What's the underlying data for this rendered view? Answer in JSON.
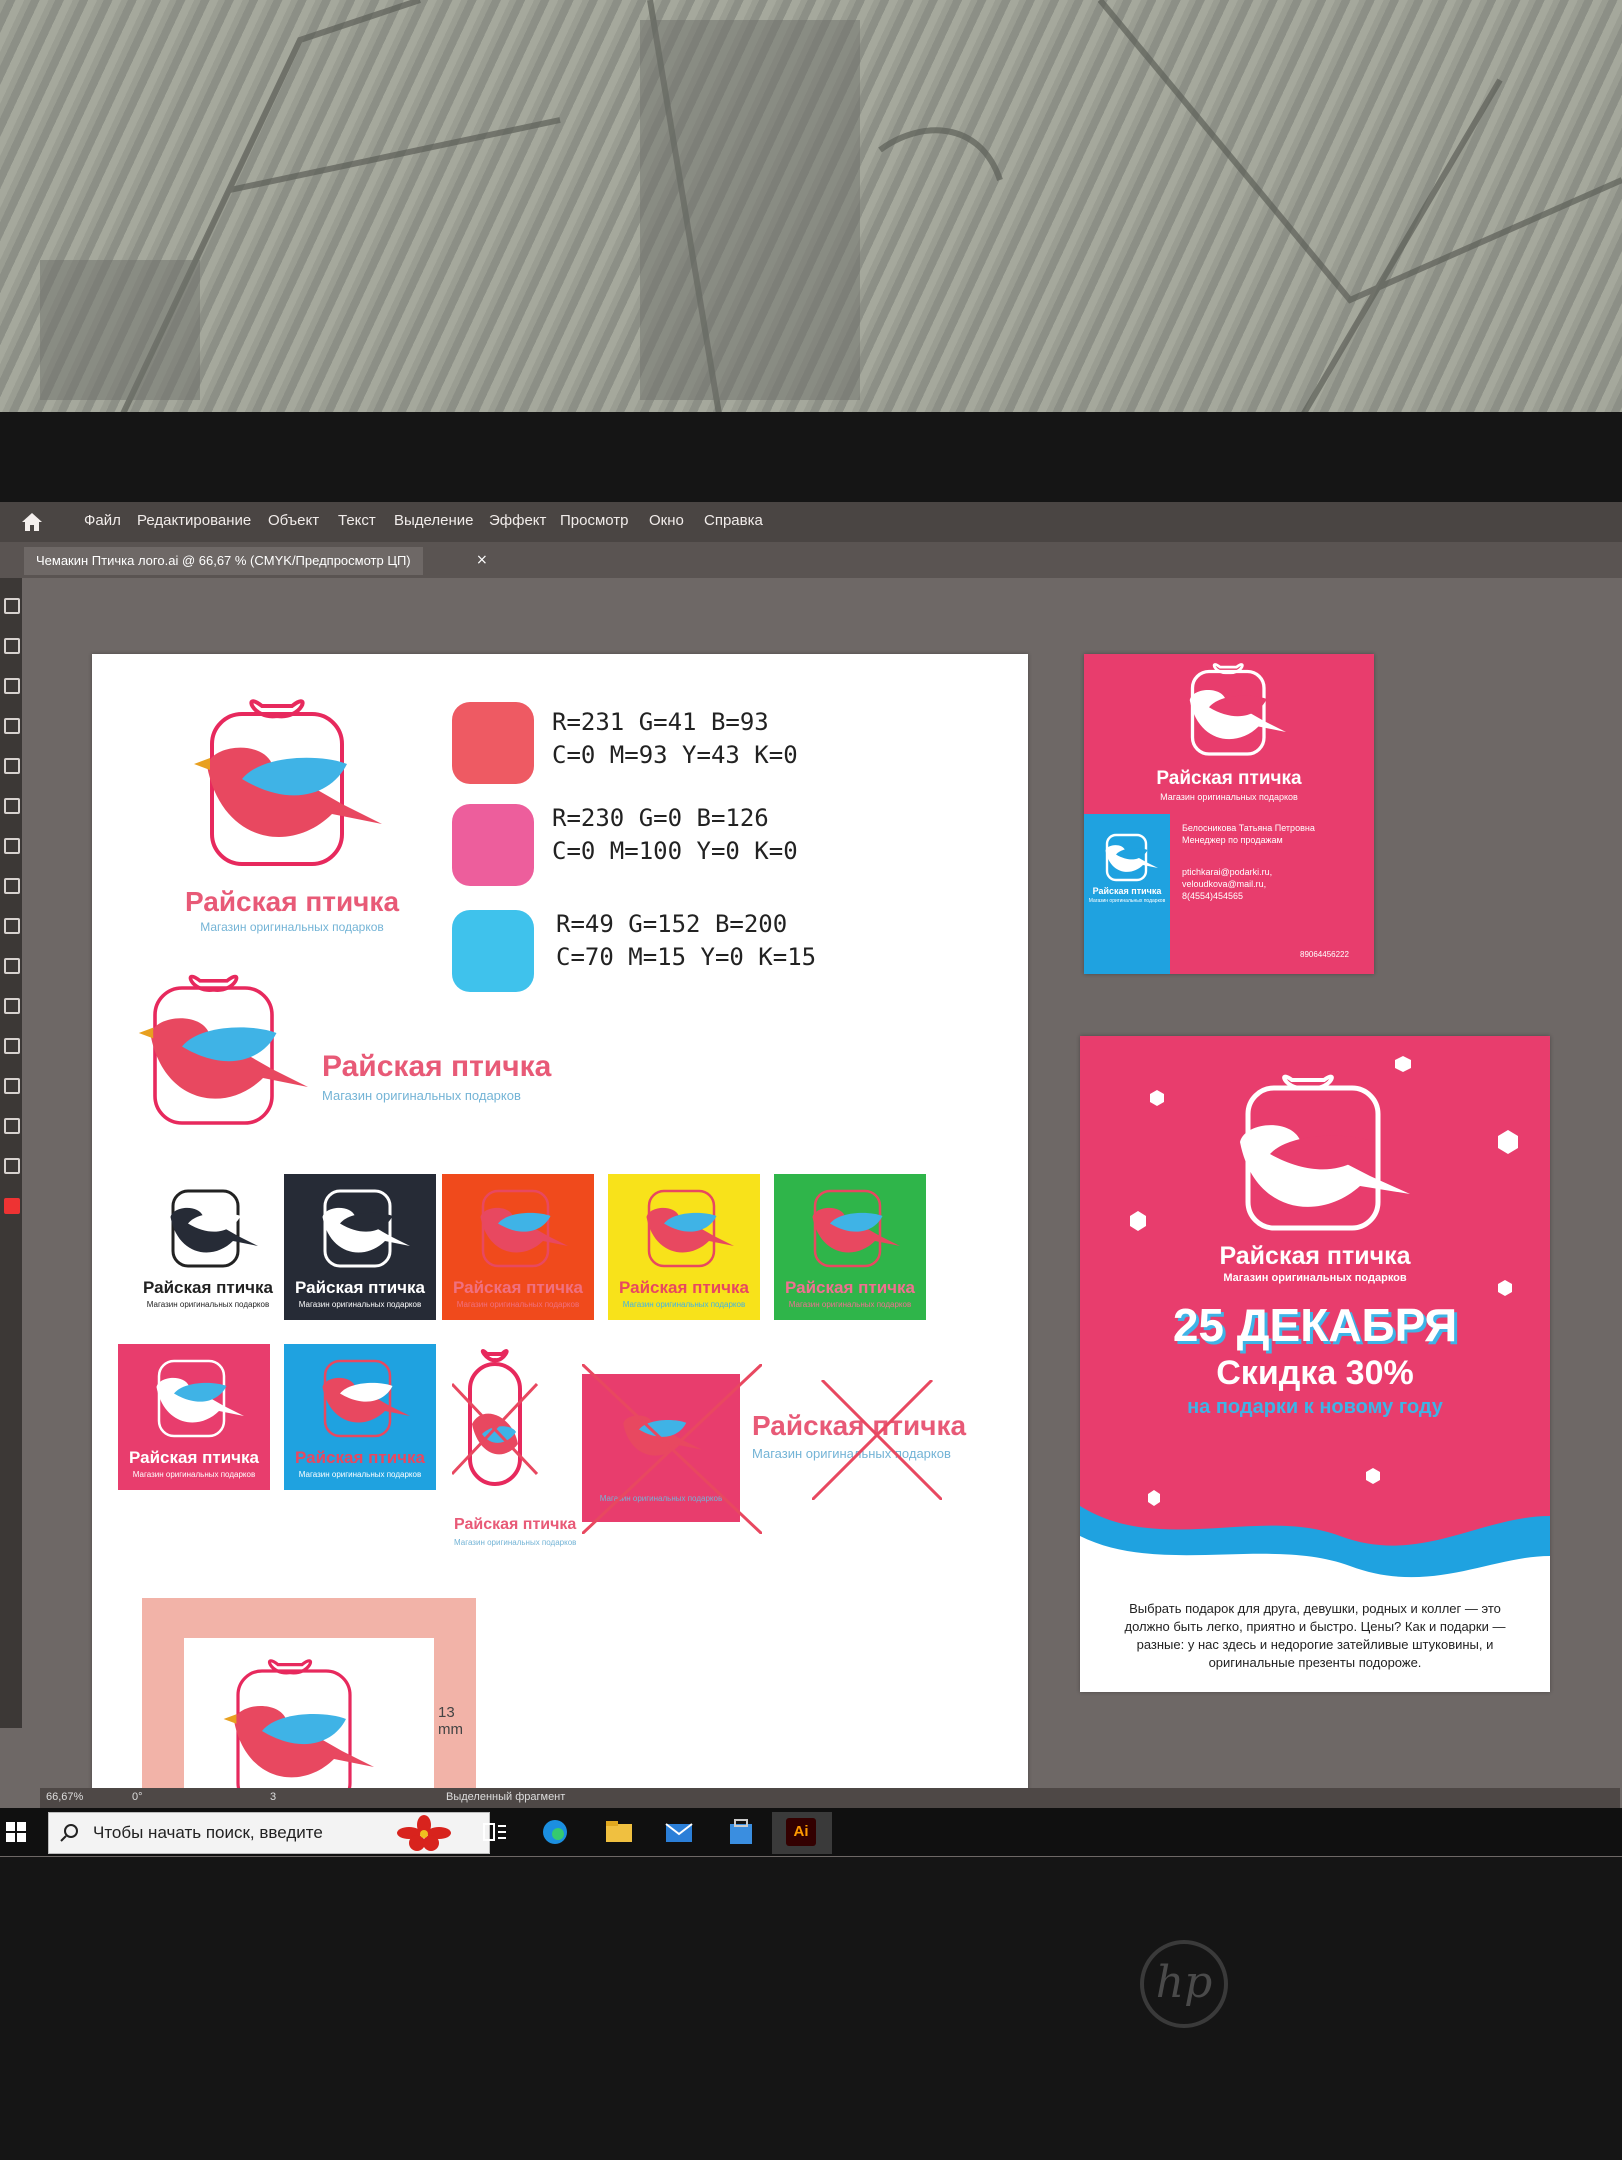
{
  "menu": {
    "items": [
      "Файл",
      "Редактирование",
      "Объект",
      "Текст",
      "Выделение",
      "Эффект",
      "Просмотр",
      "Окно",
      "Справка"
    ]
  },
  "document": {
    "tab_title": "Чемакин Птичка лого.ai @ 66,67 % (CMYK/Предпросмотр ЦП)",
    "close_glyph": "×"
  },
  "brand": {
    "name": "Райская птичка",
    "tagline": "Магазин оригинальных подарков"
  },
  "palette": [
    {
      "color": "#e7295d",
      "rgb": "R=231 G=41 B=93",
      "cmyk": "C=0 M=93 Y=43 K=0"
    },
    {
      "color": "#e6007e",
      "rgb": "R=230 G=0 B=126",
      "cmyk": "C=0 M=100 Y=0 K=0"
    },
    {
      "color": "#3198c8",
      "rgb": "R=49 G=152 B=200",
      "cmyk": "C=70 M=15 Y=0 K=15"
    }
  ],
  "swatch_display_colors": [
    "#ee5a63",
    "#ed5e9c",
    "#3fc2ec"
  ],
  "measure": {
    "value": "13",
    "unit": "mm"
  },
  "business_card": {
    "name": "Белосникова Татьяна Петровна",
    "role": "Менеджер по продажам",
    "email1": "ptichkarai@podarki.ru,",
    "email2": "veloudkova@mail.ru,",
    "phone1": "8(4554)454565",
    "phone2": "89064456222"
  },
  "flyer": {
    "date": "25 ДЕКАБРЯ",
    "discount": "Скидка 30%",
    "subline": "на подарки к новому году",
    "body": "Выбрать подарок для друга, девушки, родных и коллег — это должно быть легко, приятно и быстро. Цены? Как и подарки — разные: у нас здесь и недорогие затейливые штуковины, и оригинальные презенты подороже."
  },
  "statusbar": {
    "zoom": "66,67%",
    "rotation": "0°",
    "artboard": "3",
    "mode": "Выделенный фрагмент"
  },
  "taskbar": {
    "search_placeholder": "Чтобы начать поиск, введите",
    "ai_label": "Ai"
  },
  "laptop": {
    "logo": "hp"
  },
  "icons": [
    "home-icon",
    "search-icon",
    "windows-icon",
    "task-view-icon",
    "edge-icon",
    "explorer-icon",
    "mail-icon",
    "store-icon",
    "illustrator-icon"
  ]
}
